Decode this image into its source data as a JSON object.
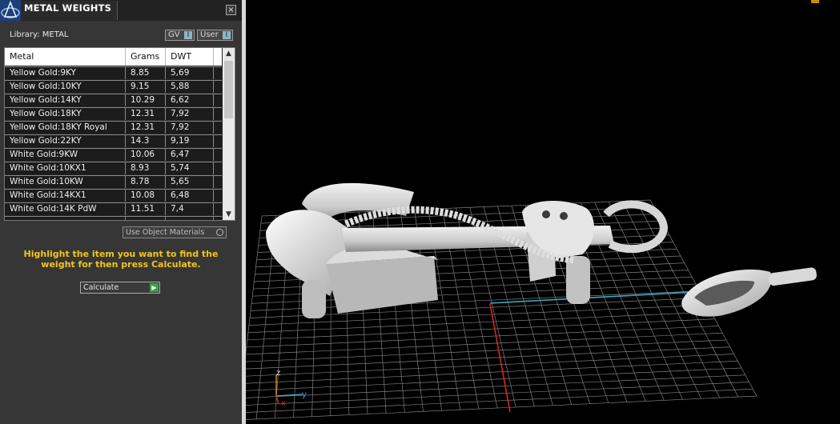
{
  "panel": {
    "title": "METAL WEIGHTS",
    "close_label": "×",
    "library_label": "Library: METAL",
    "toggles": [
      {
        "label": "GV",
        "icon": "I"
      },
      {
        "label": "User",
        "icon": "I"
      }
    ],
    "table": {
      "headers": [
        "Metal",
        "Grams",
        "DWT"
      ],
      "rows": [
        [
          "Yellow Gold:9KY",
          "8.85",
          "5,69"
        ],
        [
          "Yellow Gold:10KY",
          "9.15",
          "5,88"
        ],
        [
          "Yellow Gold:14KY",
          "10.29",
          "6,62"
        ],
        [
          "Yellow Gold:18KY",
          "12.31",
          "7,92"
        ],
        [
          "Yellow Gold:18KY Royal",
          "12.31",
          "7,92"
        ],
        [
          "Yellow Gold:22KY",
          "14.3",
          "9,19"
        ],
        [
          "White Gold:9KW",
          "10.06",
          "6,47"
        ],
        [
          "White Gold:10KX1",
          "8.93",
          "5,74"
        ],
        [
          "White Gold:10KW",
          "8.78",
          "5,65"
        ],
        [
          "White Gold:14KX1",
          "10.08",
          "6,48"
        ],
        [
          "White Gold:14K PdW",
          "11.51",
          "7,4"
        ]
      ]
    },
    "use_object_materials": "Use Object Materials",
    "hint": "Highlight the item you want to find the weight for then press Calculate.",
    "calculate_label": "Calculate"
  },
  "viewport": {
    "axes": {
      "z": "z",
      "y": "y",
      "x": "x"
    }
  },
  "colors": {
    "panel_bg": "#363636",
    "hint_yellow": "#f5c518",
    "axis_red": "#d22a1c",
    "axis_cyan": "#3aa6c0",
    "grid_gray": "#8c8c8c"
  }
}
